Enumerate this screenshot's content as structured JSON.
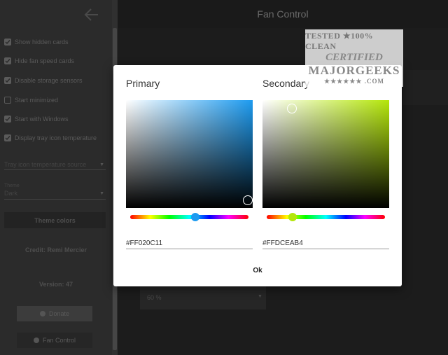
{
  "topbar": {
    "title": "Fan Control"
  },
  "sidebar": {
    "settings": [
      {
        "label": "Show hidden cards",
        "checked": true
      },
      {
        "label": "Hide fan speed cards",
        "checked": true
      },
      {
        "label": "Disable storage sensors",
        "checked": true
      },
      {
        "label": "Start minimized",
        "checked": false
      },
      {
        "label": "Start with Windows",
        "checked": true
      },
      {
        "label": "Display tray icon temperature",
        "checked": true
      }
    ],
    "tray_select": {
      "value": "Tray icon temperature source"
    },
    "theme_select": {
      "label": "Theme",
      "value": "Dark"
    },
    "theme_colors_label": "Theme colors",
    "credit": "Credit: Remi Mercier",
    "version": "Version: 47",
    "donate_label": "Donate",
    "fancontrol_label": "Fan Control"
  },
  "background": {
    "card_value": "60 %"
  },
  "dialog": {
    "primary": {
      "title": "Primary",
      "hex": "#FF020C11",
      "hue_color": "#1d9bf0",
      "hue_value": 0.55,
      "saturation": 0.96,
      "brightness": 0.07
    },
    "secondary": {
      "title": "Secondary",
      "hex": "#FFDCEAB4",
      "hue_color": "#b4e60a",
      "hue_value": 0.22,
      "saturation": 0.23,
      "brightness": 0.92
    },
    "ok_label": "Ok"
  },
  "watermark": {
    "top": "TESTED ★100% CLEAN",
    "middle": "CERTIFIED",
    "logo": "MAJORGEEKS",
    "bottom": "★★★★★★ .COM"
  }
}
